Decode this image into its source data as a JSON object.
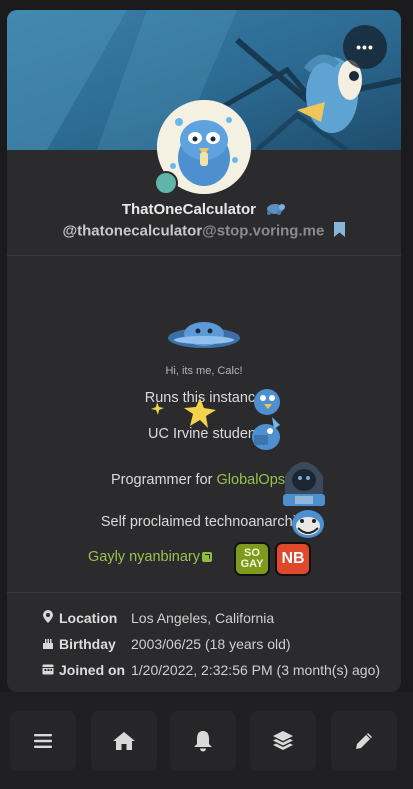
{
  "profile": {
    "display_name": "ThatOneCalculator",
    "username": "@thatonecalculator",
    "host": "@stop.voring.me"
  },
  "banner": {
    "more_label": "•••"
  },
  "bio": {
    "greeting": "Hi, its me, Calc!",
    "line1": "Runs this instance",
    "line2": "UC Irvine student",
    "line3_prefix": "Programmer for ",
    "line3_link": "GlobalOps",
    "line4": "Self proclaimed technoanarchist",
    "line5_link": "Gayly nyanbinary",
    "badge_sogay_top": "SO",
    "badge_sogay_bottom": "GAY",
    "badge_nb": "NB"
  },
  "fields": [
    {
      "label": "Location",
      "value": "Los Angeles, California",
      "icon": "map-pin-icon"
    },
    {
      "label": "Birthday",
      "value": "2003/06/25 (18 years old)",
      "icon": "cake-icon"
    },
    {
      "label": "Joined on",
      "value": "1/20/2022, 2:32:56 PM (3 month(s) ago)",
      "icon": "calendar-icon"
    }
  ],
  "nav": [
    "menu-icon",
    "home-icon",
    "bell-icon",
    "layers-icon",
    "pencil-icon"
  ],
  "colors": {
    "accent": "#8fbf3a",
    "bookmark": "#86b6d8",
    "online": "#5fb5a9",
    "badge_sogay": "#7e9a1e",
    "badge_nb": "#e0482c"
  }
}
